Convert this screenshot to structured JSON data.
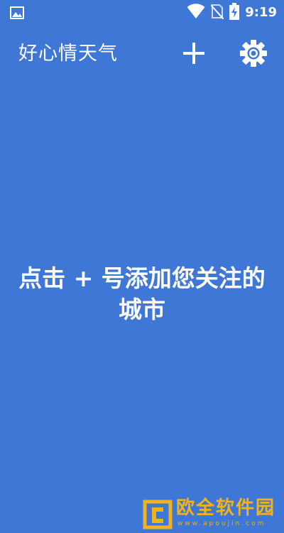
{
  "status_bar": {
    "time": "9:19",
    "icons": [
      "image-notification-icon",
      "wifi-icon",
      "no-sim-icon",
      "battery-charging-icon"
    ]
  },
  "app_bar": {
    "title": "好心情天气",
    "add_icon": "plus-icon",
    "settings_icon": "gear-icon"
  },
  "main": {
    "empty_message_line1": "点击 + 号添加您关注的",
    "empty_message_line2": "城市"
  },
  "watermark": {
    "text": "欧全软件园",
    "url": "www.apoujin.com",
    "color": "#f2b31a"
  },
  "colors": {
    "background": "#3f77d6",
    "foreground": "#ffffff"
  }
}
